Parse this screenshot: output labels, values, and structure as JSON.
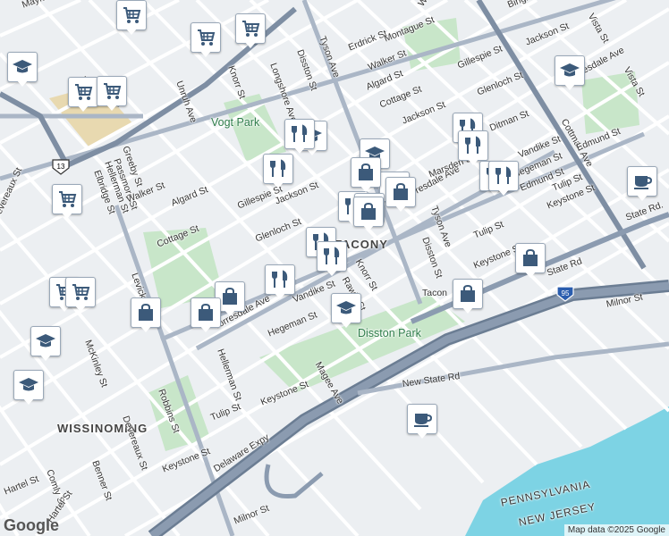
{
  "attribution": "Map data ©2025 Google",
  "brand": "Google",
  "area_labels": [
    {
      "text": "TACONY",
      "cls": "area"
    },
    {
      "text": "WISSINOMING",
      "cls": "area"
    }
  ],
  "park_labels": [
    {
      "text": "Vogt Park"
    },
    {
      "text": "Disston Park"
    }
  ],
  "state_labels": [
    {
      "text": "PENNSYLVANIA"
    },
    {
      "text": "NEW JERSEY"
    }
  ],
  "place_labels": [
    {
      "text": "Tacon"
    }
  ],
  "street_labels": [
    "Tyson Ave",
    "Disston St",
    "Longshore Ave",
    "Knorr St",
    "Unruh Ave",
    "Erdrick St",
    "Montague St",
    "Walker St",
    "Algard St",
    "Cottage St",
    "Gillespie St",
    "Jackson St",
    "Glenloch St",
    "Ditman St",
    "Vista St",
    "Torresdale Ave",
    "Cottman Ave",
    "Edmund St",
    "Vandike St",
    "Hegeman St",
    "Marsden St",
    "Tulip St",
    "Keystone St",
    "State Rd",
    "Milnor St",
    "New State Rd",
    "Delaware Expy",
    "Magee Ave",
    "Rawle St",
    "Hellerman St",
    "Levick St",
    "Robbins St",
    "Greeby St",
    "Passmore St",
    "Elbridge St",
    "Devereaux St",
    "McKinley St",
    "Benner St",
    "Comly St",
    "Mayfair St",
    "Wellington St",
    "Bingham St",
    "Hartel St",
    "State Rd."
  ],
  "shields": [
    {
      "text": "13"
    },
    {
      "text": "95"
    }
  ],
  "pins": [
    {
      "icon": "shopping-cart"
    },
    {
      "icon": "shopping-cart"
    },
    {
      "icon": "shopping-cart"
    },
    {
      "icon": "shopping-cart"
    },
    {
      "icon": "shopping-cart"
    },
    {
      "icon": "shopping-cart"
    },
    {
      "icon": "shopping-cart"
    },
    {
      "icon": "shopping-cart"
    },
    {
      "icon": "school"
    },
    {
      "icon": "school"
    },
    {
      "icon": "school"
    },
    {
      "icon": "school"
    },
    {
      "icon": "school"
    },
    {
      "icon": "school"
    },
    {
      "icon": "school"
    },
    {
      "icon": "restaurant"
    },
    {
      "icon": "restaurant"
    },
    {
      "icon": "restaurant"
    },
    {
      "icon": "restaurant"
    },
    {
      "icon": "restaurant"
    },
    {
      "icon": "restaurant"
    },
    {
      "icon": "restaurant"
    },
    {
      "icon": "restaurant"
    },
    {
      "icon": "restaurant"
    },
    {
      "icon": "restaurant"
    },
    {
      "icon": "restaurant"
    },
    {
      "icon": "shopping-bag"
    },
    {
      "icon": "shopping-bag"
    },
    {
      "icon": "shopping-bag"
    },
    {
      "icon": "shopping-bag"
    },
    {
      "icon": "shopping-bag"
    },
    {
      "icon": "shopping-bag"
    },
    {
      "icon": "shopping-bag"
    },
    {
      "icon": "shopping-bag"
    },
    {
      "icon": "shopping-bag"
    },
    {
      "icon": "cafe"
    },
    {
      "icon": "cafe"
    }
  ],
  "colors": {
    "land": "#eceff2",
    "road_minor": "#ffffff",
    "road_major": "#aab6c6",
    "highway": "#7e8ea3",
    "park": "#c8e6c9",
    "water": "#7dd3e4",
    "industrial": "#e8d9b0",
    "icon": "#3c5a7a"
  }
}
